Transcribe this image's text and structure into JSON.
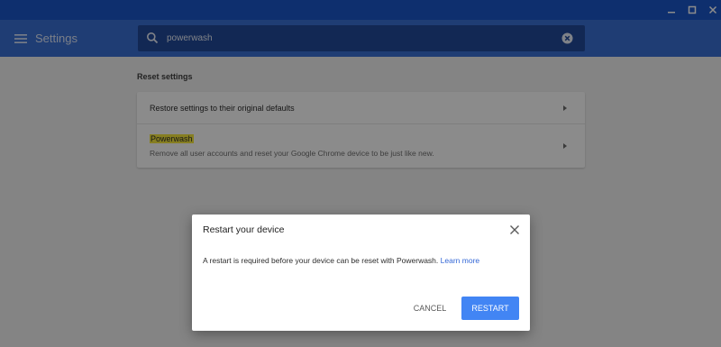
{
  "header": {
    "menu_icon": "hamburger-menu-icon",
    "title": "Settings",
    "search": {
      "value": "powerwash",
      "search_icon": "search-icon",
      "clear_icon": "clear-circle-icon"
    }
  },
  "window_controls": {
    "minimize_icon": "minimize-icon",
    "maximize_icon": "maximize-icon",
    "close_icon": "close-icon"
  },
  "section": {
    "title": "Reset settings",
    "items": [
      {
        "label": "Restore settings to their original defaults",
        "arrow_icon": "arrow-right-icon"
      },
      {
        "label": "Powerwash",
        "description": "Remove all user accounts and reset your Google Chrome device to be just like new.",
        "arrow_icon": "arrow-right-icon"
      }
    ]
  },
  "dialog": {
    "title": "Restart your device",
    "close_icon": "close-icon",
    "body": "A restart is required before your device can be reset with Powerwash.",
    "link": "Learn more",
    "cancel_label": "CANCEL",
    "restart_label": "RESTART"
  },
  "colors": {
    "titlebar": "#1a56c9",
    "header": "#3a6fd3",
    "search_box": "#224a9a",
    "highlight": "#f5e63c",
    "accent": "#4285f4",
    "link": "#3367d6"
  }
}
